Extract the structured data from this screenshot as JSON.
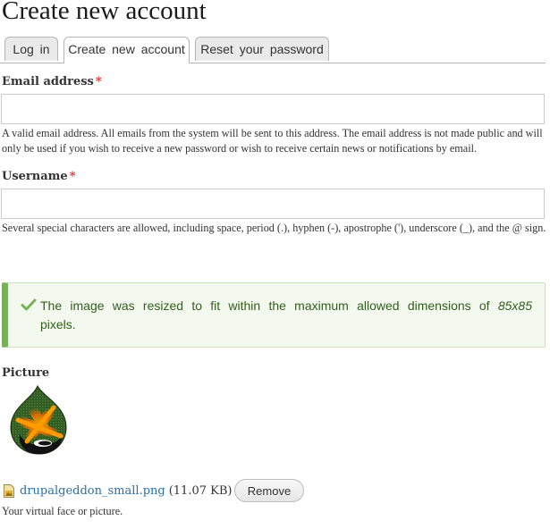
{
  "page": {
    "title": "Create new account"
  },
  "tabs": [
    {
      "label": "Log in",
      "active": false
    },
    {
      "label": "Create new account",
      "active": true
    },
    {
      "label": "Reset your password",
      "active": false
    }
  ],
  "form": {
    "required_marker": "*",
    "email": {
      "label": "Email address",
      "value": "",
      "placeholder": "",
      "description": "A valid email address. All emails from the system will be sent to this address. The email address is not made public and will only be used if you wish to receive a new password or wish to receive certain news or notifications by email."
    },
    "username": {
      "label": "Username",
      "value": "",
      "placeholder": "",
      "description": "Several special characters are allowed, including space, period (.), hyphen (-), apostrophe ('), underscore (_), and the @ sign."
    }
  },
  "status_message": {
    "type": "success",
    "icon": "checkmark-icon",
    "text_before": "The image was resized to fit within the maximum allowed dimensions of ",
    "dimensions": "85x85",
    "text_after": " pixels."
  },
  "picture": {
    "label": "Picture",
    "file_icon": "image-file-icon",
    "file_name": "drupalgeddon_small.png",
    "file_size": "(11.07 KB)",
    "remove_label": "Remove",
    "description": "Your virtual face or picture."
  },
  "colors": {
    "success_border": "#77b259",
    "success_bg": "#f3f9ef",
    "success_text": "#325e1c",
    "link": "#2a6fa8",
    "required": "#e42b2b"
  }
}
